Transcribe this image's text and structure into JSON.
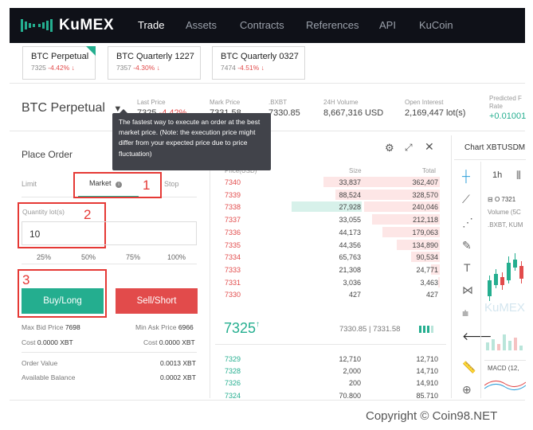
{
  "nav": {
    "logo": "KuMEX",
    "items": [
      "Trade",
      "Assets",
      "Contracts",
      "References",
      "API",
      "KuCoin"
    ]
  },
  "markets": [
    {
      "name": "BTC Perpetual",
      "price": "7325",
      "change": "-4.42% ↓"
    },
    {
      "name": "BTC Quarterly 1227",
      "price": "7357",
      "change": "-4.30% ↓"
    },
    {
      "name": "BTC Quarterly 0327",
      "price": "7474",
      "change": "-4.51% ↓"
    }
  ],
  "ticker": {
    "title": "BTC Perpetual",
    "last_price_label": "Last Price",
    "last_price": "7325",
    "last_change": "-4.42%",
    "mark_price_label": "Mark Price",
    "mark_price": "7331.58",
    "index_label": ".BXBT",
    "index": "7330.85",
    "volume_label": "24H Volume",
    "volume": "8,667,316 USD",
    "oi_label": "Open Interest",
    "oi": "2,169,447 lot(s)",
    "funding_label": "Predicted F Rate",
    "funding": "+0.01001"
  },
  "tooltip": "The fastest way to execute an order at the best market price. (Note: the execution price might differ from your expected price due to price fluctuation)",
  "order": {
    "title": "Place Order",
    "tabs": [
      "Limit",
      "Market",
      "Stop"
    ],
    "qty_label": "Quantity lot(s)",
    "qty_value": "10",
    "percents": [
      "25%",
      "50%",
      "75%",
      "100%"
    ],
    "buy_label": "Buy/Long",
    "sell_label": "Sell/Short",
    "max_bid_label": "Max Bid Price",
    "max_bid": "7698",
    "min_ask_label": "Min Ask Price",
    "min_ask": "6966",
    "cost_label": "Cost",
    "cost_buy": "0.0000 XBT",
    "cost_sell": "0.0000 XBT",
    "order_value_label": "Order Value",
    "order_value": "0.0013 XBT",
    "available_label": "Available Balance",
    "available": "0.0002 XBT",
    "annotations": [
      "1",
      "2",
      "3"
    ]
  },
  "orderbook": {
    "title_partial": "k",
    "headers": [
      "Price(USD)",
      "Size",
      "Total"
    ],
    "asks": [
      {
        "price": "7340",
        "size": "33,837",
        "total": "362,407",
        "depth": 0.81
      },
      {
        "price": "7339",
        "size": "88,524",
        "total": "328,570",
        "depth": 0.73
      },
      {
        "price": "7338",
        "size": "27,928",
        "total": "240,046",
        "depth": 0.53
      },
      {
        "price": "7337",
        "size": "33,055",
        "total": "212,118",
        "depth": 0.47
      },
      {
        "price": "7336",
        "size": "44,173",
        "total": "179,063",
        "depth": 0.4
      },
      {
        "price": "7335",
        "size": "44,356",
        "total": "134,890",
        "depth": 0.3
      },
      {
        "price": "7334",
        "size": "65,763",
        "total": "90,534",
        "depth": 0.2
      },
      {
        "price": "7333",
        "size": "21,308",
        "total": "24,771",
        "depth": 0.06
      },
      {
        "price": "7331",
        "size": "3,036",
        "total": "3,463",
        "depth": 0.01
      },
      {
        "price": "7330",
        "size": "427",
        "total": "427",
        "depth": 0.0
      }
    ],
    "last_price": "7325",
    "last_arrow": "↑",
    "index": "7330.85",
    "mark": "7331.58",
    "bids": [
      {
        "price": "7329",
        "size": "12,710",
        "total": "12,710"
      },
      {
        "price": "7328",
        "size": "2,000",
        "total": "14,710"
      },
      {
        "price": "7326",
        "size": "200",
        "total": "14,910"
      },
      {
        "price": "7324",
        "size": "70,800",
        "total": "85,710"
      }
    ]
  },
  "chart": {
    "title": "Chart XBTUSDM",
    "interval": "1h",
    "ohlc_partial": "O 7321",
    "volume_label": "Volume (5C",
    "source": ".BXBT, KUM",
    "macd": "MACD (12,",
    "watermark": "KuMEX"
  },
  "copyright": "Copyright © Coin98.NET"
}
